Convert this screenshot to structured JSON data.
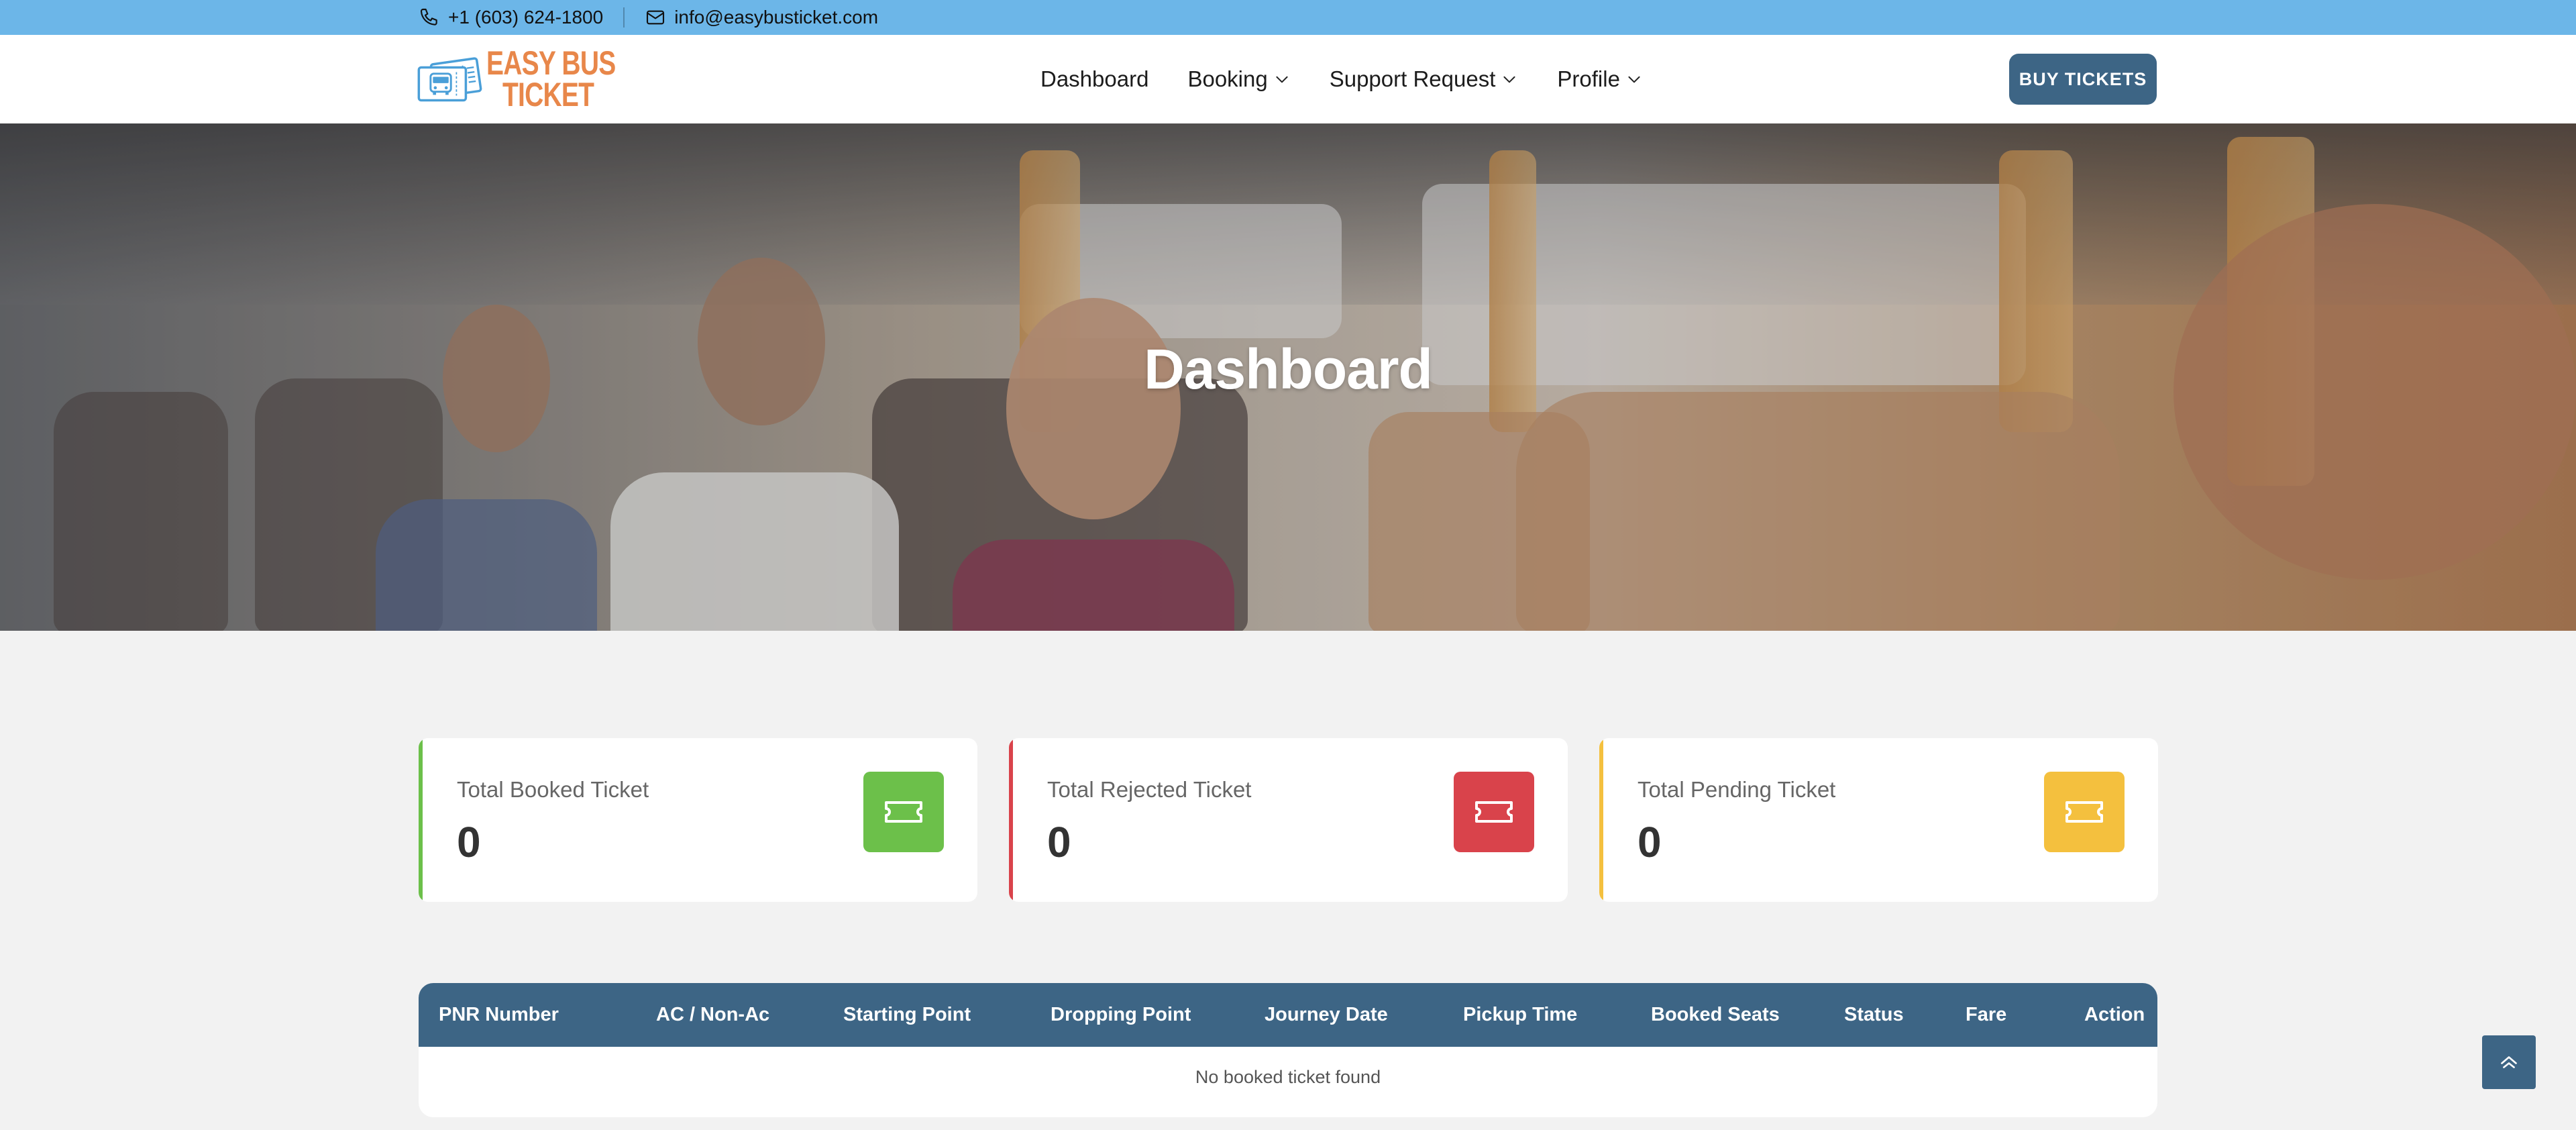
{
  "topbar": {
    "phone": "+1 (603) 624-1800",
    "email": "info@easybusticket.com"
  },
  "logo": {
    "line1": "EASY BUS",
    "line2": "TICKET"
  },
  "nav": {
    "items": [
      {
        "label": "Dashboard",
        "dropdown": false
      },
      {
        "label": "Booking",
        "dropdown": true
      },
      {
        "label": "Support Request",
        "dropdown": true
      },
      {
        "label": "Profile",
        "dropdown": true
      }
    ],
    "buy_button": "BUY TICKETS"
  },
  "hero": {
    "title": "Dashboard"
  },
  "stats": [
    {
      "label": "Total Booked Ticket",
      "value": "0",
      "color": "#6cc04a"
    },
    {
      "label": "Total Rejected Ticket",
      "value": "0",
      "color": "#d9434b"
    },
    {
      "label": "Total Pending Ticket",
      "value": "0",
      "color": "#f4c03e"
    }
  ],
  "table": {
    "columns": [
      "PNR Number",
      "AC / Non-Ac",
      "Starting Point",
      "Dropping Point",
      "Journey Date",
      "Pickup Time",
      "Booked Seats",
      "Status",
      "Fare",
      "Action"
    ],
    "empty_message": "No booked ticket found"
  },
  "colors": {
    "topbar": "#6cb6e8",
    "primary": "#3d6585",
    "logo_orange": "#e8874a",
    "logo_blue": "#4a9fd8"
  }
}
